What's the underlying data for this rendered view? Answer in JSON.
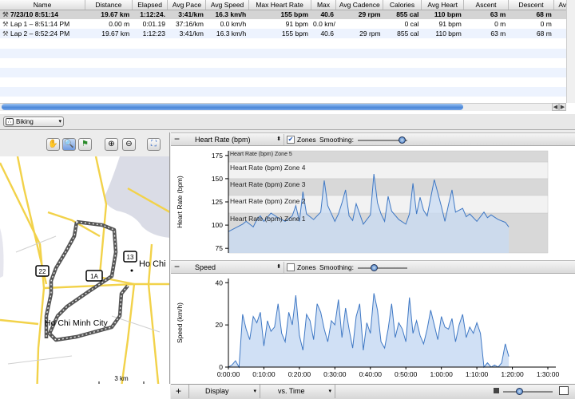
{
  "table": {
    "columns": [
      "Name",
      "Distance",
      "Elapsed",
      "Avg Pace",
      "Avg Speed",
      "Max Heart Rate",
      "Max",
      "Avg Cadence",
      "Calories",
      "Avg Heart",
      "Ascent",
      "Descent",
      "Avg"
    ],
    "rows": [
      {
        "name": "7/23/10 8:51:14",
        "distance": "19.67 km",
        "elapsed": "1:12:24.",
        "pace": "3:41/km",
        "speed": "16.3 km/h",
        "maxhr": "155 bpm",
        "max": "40.6",
        "cadence": "29 rpm",
        "calories": "855 cal",
        "avghr": "110 bpm",
        "ascent": "63 m",
        "descent": "68 m"
      },
      {
        "name": "Lap 1 – 8:51:14 PM",
        "distance": "0.00 m",
        "elapsed": "0:01.19",
        "pace": "37:16/km",
        "speed": "0.0 km/h",
        "maxhr": "91 bpm",
        "max": "0.0 km/",
        "cadence": "",
        "calories": "0 cal",
        "avghr": "91 bpm",
        "ascent": "0 m",
        "descent": "0 m"
      },
      {
        "name": "Lap 2 – 8:52:24 PM",
        "distance": "19.67 km",
        "elapsed": "1:12:23",
        "pace": "3:41/km",
        "speed": "16.3 km/h",
        "maxhr": "155 bpm",
        "max": "40.6",
        "cadence": "29 rpm",
        "calories": "855 cal",
        "avghr": "110 bpm",
        "ascent": "63 m",
        "descent": "68 m"
      }
    ]
  },
  "activity": {
    "selected": "Biking",
    "icon": "bike-icon"
  },
  "map": {
    "city_label": "Ho Chi Minh City",
    "edge_label": "Ho Chi",
    "shields": [
      "22",
      "1A",
      "13"
    ],
    "scale": "3 km",
    "overzoom": "overzoom",
    "tools": [
      "hand-tool-icon",
      "zoom-tool-icon",
      "flag-tool-icon",
      "zoom-in-icon",
      "zoom-out-icon",
      "fit-map-icon"
    ]
  },
  "hr_panel": {
    "selector": "Heart Rate (bpm)",
    "zones_label": "Zones",
    "zones_checked": true,
    "smoothing_label": "Smoothing:",
    "smoothing": 0.88
  },
  "speed_panel": {
    "selector": "Speed",
    "zones_label": "Zones",
    "zones_checked": false,
    "smoothing_label": "Smoothing:",
    "smoothing": 0.32
  },
  "bottom": {
    "display": "Display",
    "vs": "vs. Time",
    "zoom": 0.32
  },
  "colors": {
    "line": "#3f78c4",
    "fill": "#c8dbf3",
    "zone": "#d8d8d8",
    "zone_alt": "#f2f2f2"
  },
  "chart_data": [
    {
      "type": "area",
      "ylabel": "Heart Rate (bpm)",
      "ylim": [
        70,
        180
      ],
      "yticks": [
        75,
        100,
        125,
        150,
        175
      ],
      "zones": [
        "Heart Rate (bpm) Zone 1",
        "Heart Rate (bpm) Zone 2",
        "Heart Rate (bpm) Zone 3",
        "Heart Rate (bpm) Zone 4",
        "Heart Rate (bpm) Zone 5"
      ],
      "zone_bounds": [
        [
          70,
          113
        ],
        [
          113,
          132
        ],
        [
          132,
          150
        ],
        [
          150,
          168
        ],
        [
          168,
          180
        ]
      ],
      "x_minutes": [
        0,
        2,
        4,
        5,
        7,
        8,
        9,
        10,
        12,
        14,
        16,
        18,
        19,
        20,
        21,
        22,
        24,
        26,
        27,
        28,
        30,
        31,
        32,
        33,
        34,
        35,
        36,
        38,
        40,
        41,
        42,
        43,
        44,
        45,
        46,
        48,
        50,
        51,
        52,
        53,
        54,
        55,
        56,
        58,
        60,
        61,
        62,
        63,
        64,
        66,
        67,
        68,
        70,
        72,
        73,
        74,
        76,
        78,
        79
      ],
      "values": [
        93,
        97,
        101,
        104,
        98,
        106,
        110,
        104,
        113,
        108,
        104,
        110,
        121,
        104,
        136,
        112,
        106,
        114,
        148,
        121,
        104,
        112,
        124,
        138,
        110,
        105,
        123,
        101,
        111,
        155,
        124,
        112,
        104,
        131,
        115,
        106,
        101,
        112,
        145,
        112,
        130,
        116,
        110,
        149,
        120,
        104,
        122,
        138,
        114,
        118,
        109,
        112,
        104,
        114,
        108,
        111,
        106,
        103,
        98
      ]
    },
    {
      "type": "area",
      "ylabel": "Speed (km/h)",
      "ylim": [
        0,
        42
      ],
      "yticks": [
        0,
        20,
        40
      ],
      "xticks": [
        "0:00:00",
        "0:10:00",
        "0:20:00",
        "0:30:00",
        "0:40:00",
        "0:50:00",
        "1:00:00",
        "1:10:00",
        "1:20:00",
        "1:30:00"
      ],
      "x_minutes": [
        0,
        1,
        2,
        3,
        4,
        5,
        6,
        7,
        8,
        9,
        10,
        11,
        12,
        13,
        14,
        15,
        16,
        17,
        18,
        19,
        20,
        21,
        22,
        23,
        24,
        25,
        26,
        27,
        28,
        29,
        30,
        31,
        32,
        33,
        34,
        35,
        36,
        37,
        38,
        39,
        40,
        41,
        42,
        43,
        44,
        45,
        46,
        47,
        48,
        49,
        50,
        51,
        52,
        53,
        54,
        55,
        56,
        57,
        58,
        59,
        60,
        61,
        62,
        63,
        64,
        65,
        66,
        67,
        68,
        69,
        70,
        71,
        72,
        73,
        74,
        75,
        76,
        77,
        78,
        79
      ],
      "values": [
        0,
        1,
        3,
        0,
        25,
        18,
        13,
        24,
        21,
        26,
        10,
        22,
        17,
        19,
        30,
        16,
        12,
        26,
        20,
        34,
        15,
        8,
        25,
        22,
        13,
        30,
        26,
        18,
        12,
        22,
        20,
        32,
        14,
        28,
        18,
        9,
        24,
        30,
        8,
        21,
        16,
        35,
        27,
        12,
        9,
        18,
        30,
        14,
        21,
        18,
        12,
        33,
        16,
        22,
        15,
        11,
        18,
        27,
        20,
        13,
        24,
        19,
        18,
        23,
        12,
        20,
        25,
        14,
        19,
        16,
        21,
        16,
        0,
        2,
        0,
        1,
        0,
        2,
        11,
        5
      ]
    }
  ]
}
